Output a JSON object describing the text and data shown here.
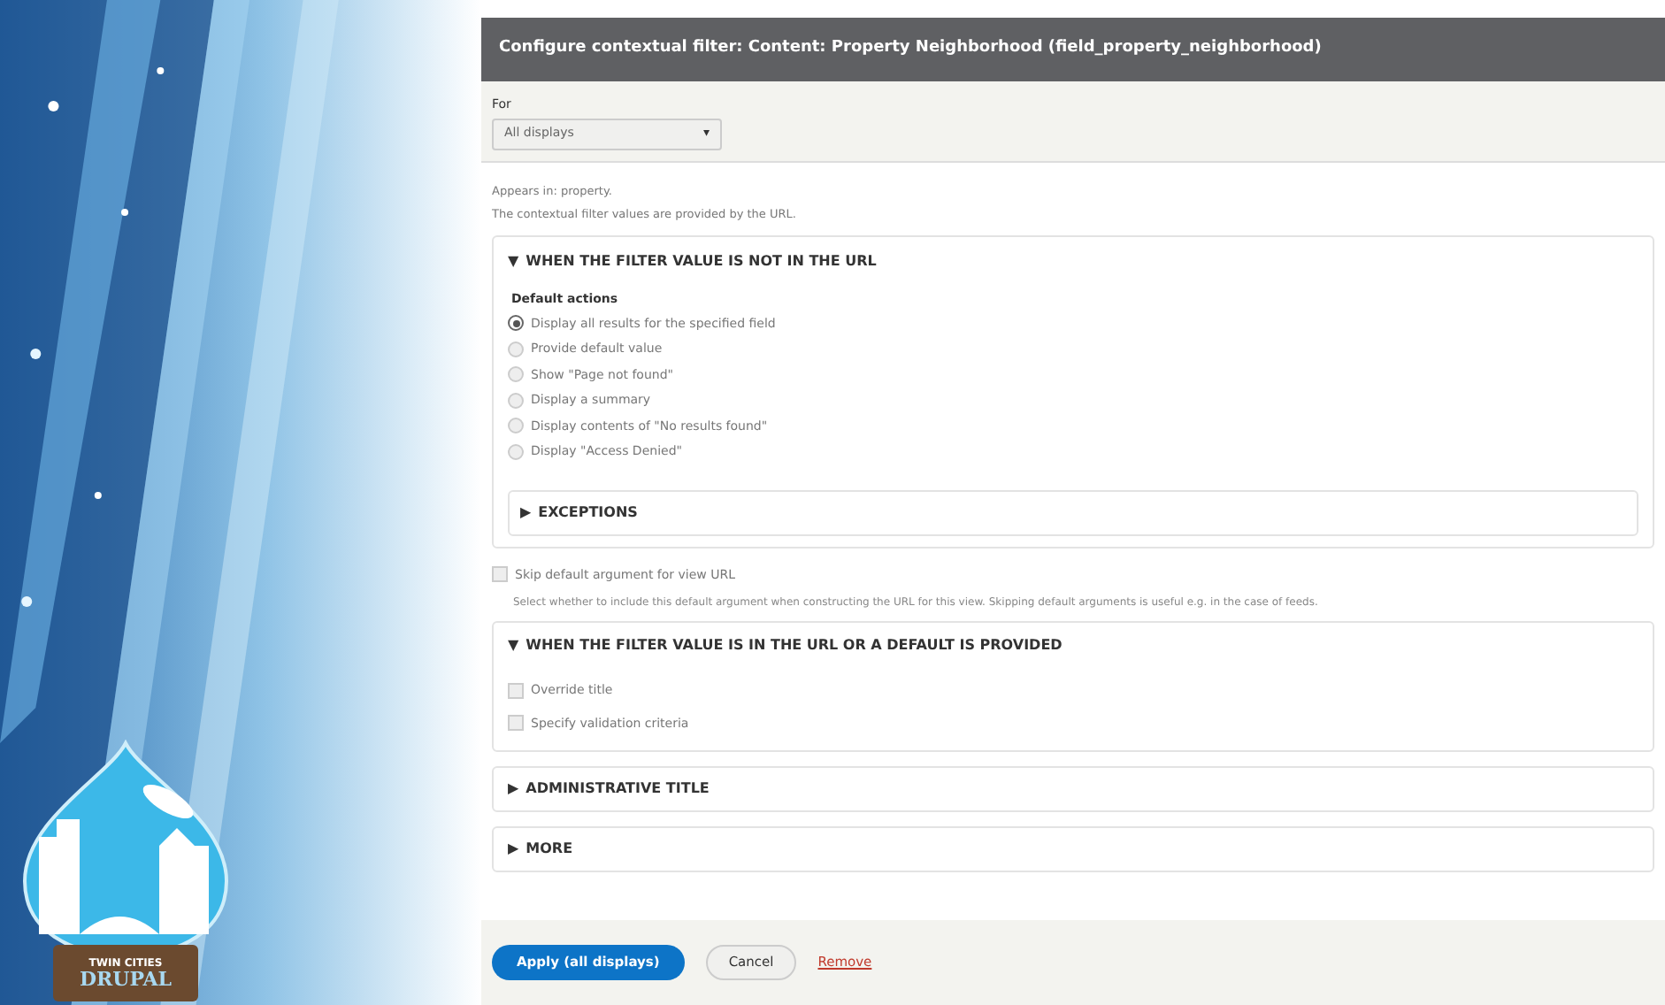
{
  "logo": {
    "line1": "TWIN CITIES",
    "line2": "DRUPAL"
  },
  "dialog": {
    "title": "Configure contextual filter: Content: Property Neighborhood (field_property_neighborhood)",
    "for_label": "For",
    "for_select": {
      "value": "All displays",
      "caret": "▾"
    },
    "appears_in": "Appears in: property.",
    "intro": "The contextual filter values are provided by the URL.",
    "no_value_section": {
      "marker": "▼",
      "title": "WHEN THE FILTER VALUE IS NOT IN THE URL",
      "group_label": "Default actions",
      "options": [
        {
          "label": "Display all results for the specified field",
          "selected": true
        },
        {
          "label": "Provide default value",
          "selected": false
        },
        {
          "label": "Show \"Page not found\"",
          "selected": false
        },
        {
          "label": "Display a summary",
          "selected": false
        },
        {
          "label": "Display contents of \"No results found\"",
          "selected": false
        },
        {
          "label": "Display \"Access Denied\"",
          "selected": false
        }
      ],
      "exceptions": {
        "marker": "▶",
        "title": "EXCEPTIONS"
      }
    },
    "skip_default": {
      "label": "Skip default argument for view URL",
      "checked": false,
      "description": "Select whether to include this default argument when constructing the URL for this view. Skipping default arguments is useful e.g. in the case of feeds."
    },
    "value_section": {
      "marker": "▼",
      "title": "WHEN THE FILTER VALUE IS IN THE URL OR A DEFAULT IS PROVIDED",
      "checks": [
        {
          "label": "Override title",
          "checked": false
        },
        {
          "label": "Specify validation criteria",
          "checked": false
        }
      ]
    },
    "collapsed_sections": [
      {
        "marker": "▶",
        "title": "ADMINISTRATIVE TITLE"
      },
      {
        "marker": "▶",
        "title": "MORE"
      }
    ],
    "buttons": [
      {
        "kind": "primary",
        "label": "Apply (all displays)"
      },
      {
        "kind": "secondary",
        "label": "Cancel"
      },
      {
        "kind": "link",
        "label": "Remove"
      }
    ]
  }
}
